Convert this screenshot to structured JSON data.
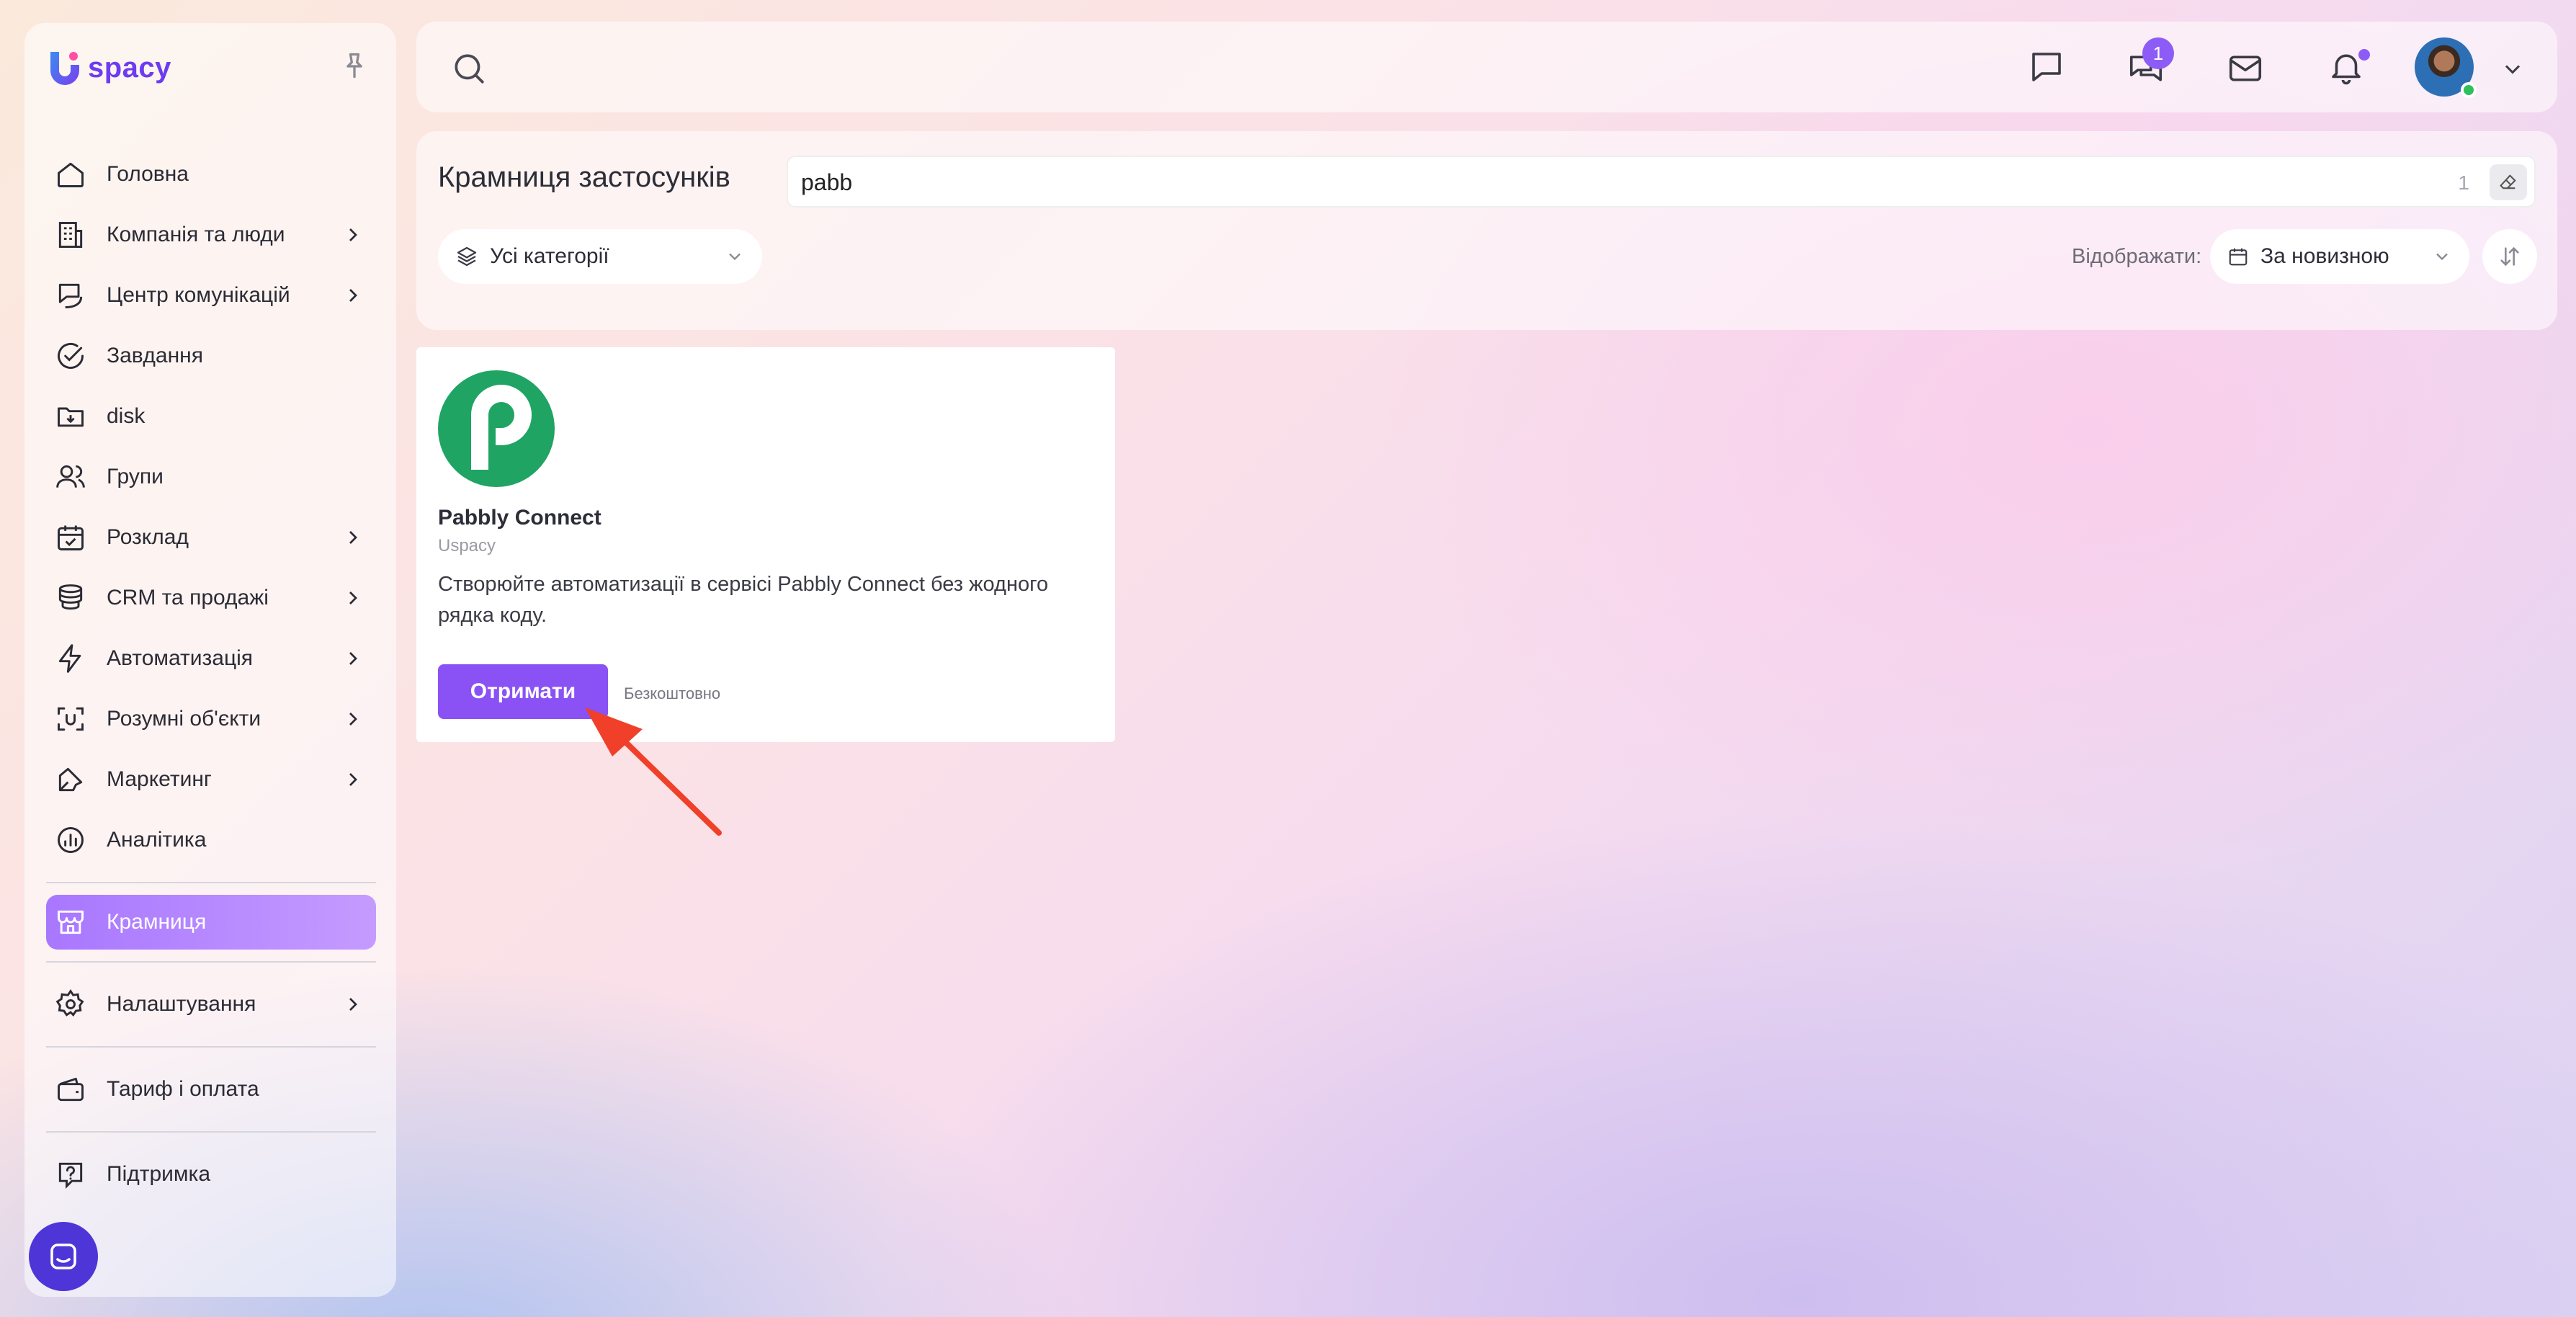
{
  "brand": {
    "name": "spacy",
    "accent": "#6d3cf0"
  },
  "sidebar": {
    "items": [
      {
        "label": "Головна",
        "icon": "home-icon",
        "has_children": false
      },
      {
        "label": "Компанія та люди",
        "icon": "building-icon",
        "has_children": true
      },
      {
        "label": "Центр комунікацій",
        "icon": "chat-route-icon",
        "has_children": true
      },
      {
        "label": "Завдання",
        "icon": "check-circle-icon",
        "has_children": false
      },
      {
        "label": "disk",
        "icon": "folder-download-icon",
        "has_children": false
      },
      {
        "label": "Групи",
        "icon": "users-icon",
        "has_children": false
      },
      {
        "label": "Розклад",
        "icon": "calendar-check-icon",
        "has_children": true
      },
      {
        "label": "CRM та продажі",
        "icon": "coins-icon",
        "has_children": true
      },
      {
        "label": "Автоматизація",
        "icon": "lightning-icon",
        "has_children": true
      },
      {
        "label": "Розумні об'єкти",
        "icon": "scan-face-icon",
        "has_children": true
      },
      {
        "label": "Маркетинг",
        "icon": "marketing-icon",
        "has_children": true
      },
      {
        "label": "Аналітика",
        "icon": "chart-circle-icon",
        "has_children": false
      },
      {
        "label": "Крамниця",
        "icon": "store-icon",
        "has_children": false,
        "active": true
      },
      {
        "label": "Налаштування",
        "icon": "gear-icon",
        "has_children": true
      },
      {
        "label": "Тариф і оплата",
        "icon": "wallet-icon",
        "has_children": false
      },
      {
        "label": "Підтримка",
        "icon": "help-icon",
        "has_children": false
      }
    ],
    "active_color": "#a877ff"
  },
  "topbar": {
    "chat_badge": "1"
  },
  "store": {
    "title": "Крамниця застосунків",
    "search": {
      "value": "pabb",
      "count": "1"
    },
    "category": "Усі категорії",
    "show_label": "Відображати:",
    "sort": "За новизною"
  },
  "apps": [
    {
      "name": "Pabbly Connect",
      "vendor": "Uspacy",
      "description": "Створюйте автоматизації в сервісі Pabbly Connect без жодного рядка коду.",
      "button": "Отримати",
      "price": "Безкоштовно",
      "logo_color": "#1fa463"
    }
  ]
}
